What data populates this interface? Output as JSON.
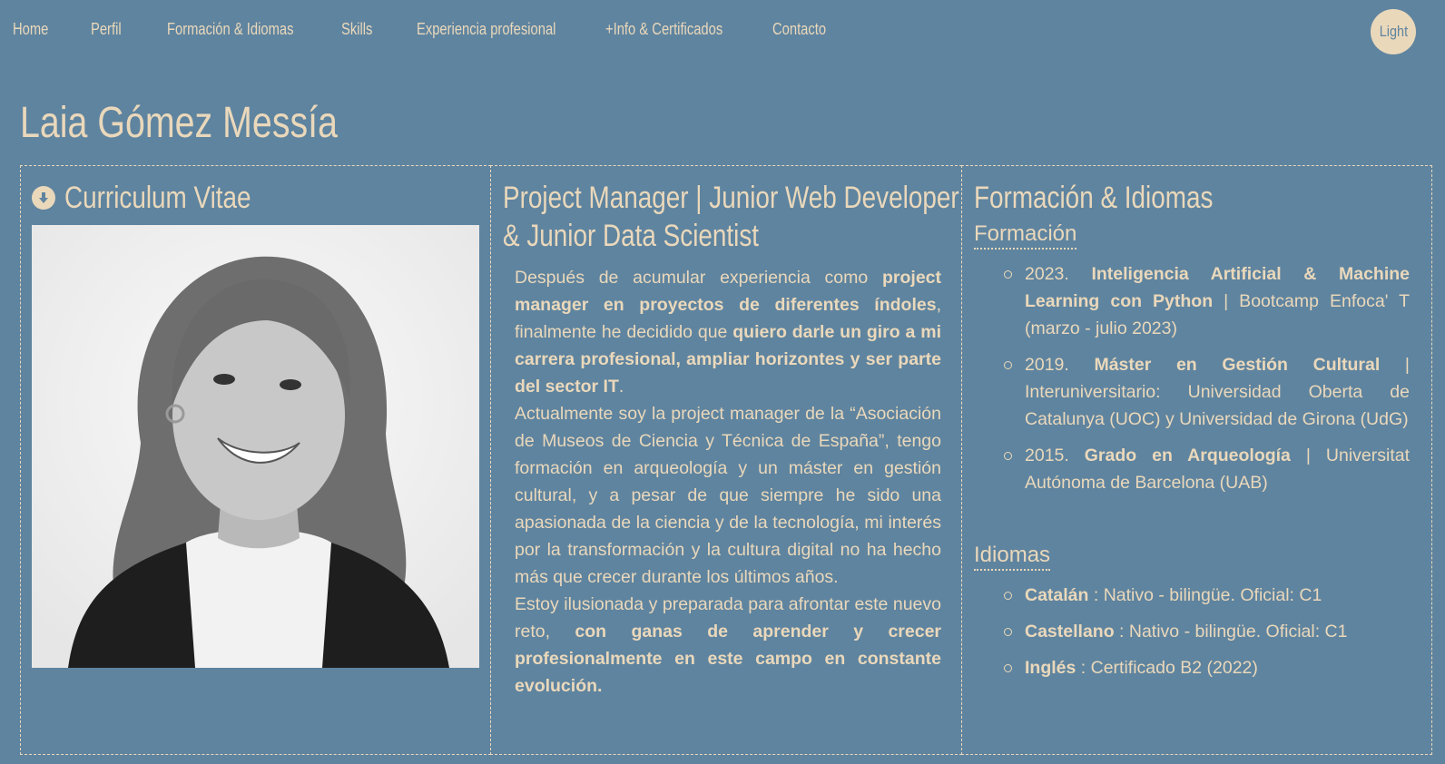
{
  "nav": {
    "items": [
      {
        "label": "Home"
      },
      {
        "label": "Perfil"
      },
      {
        "label": "Formación & Idiomas"
      },
      {
        "label": "Skills"
      },
      {
        "label": "Experiencia profesional"
      },
      {
        "label": "+Info & Certificados"
      },
      {
        "label": "Contacto"
      }
    ],
    "theme_toggle": "Light"
  },
  "name": "Laia Gómez Messía",
  "cv": {
    "title": "Curriculum Vitae",
    "download_icon": "download-circle-icon"
  },
  "profile": {
    "title_line1": "Project Manager | Junior Web Developer",
    "title_line2": "& Junior Data Scientist",
    "p1_a": "Después de acumular experiencia como ",
    "p1_b": "project manager en proyectos de diferentes índoles",
    "p1_c": ", finalmente he decidido que ",
    "p1_d": "quiero darle un giro a mi carrera profesional, ampliar horizontes y ser parte del sector IT",
    "p1_e": ".",
    "p2": "Actualmente soy la project manager de la “Asociación de Museos de Ciencia y Técnica de España”, tengo formación en arqueología y un máster en gestión cultural, y a pesar de que siempre he sido una apasionada de la ciencia y de la tecnología, mi interés por la transformación y la cultura digital no ha hecho más que crecer durante los últimos años.",
    "p3_a": "Estoy ilusionada y preparada para afrontar este nuevo reto, ",
    "p3_b": "con ganas de aprender y crecer profesionalmente en este campo en constante evolución."
  },
  "education": {
    "title": "Formación & Idiomas",
    "formacion_heading": "Formación",
    "formacion": [
      {
        "year": "2023. ",
        "title": "Inteligencia Artificial & Machine Learning con Python",
        "rest": " | Bootcamp Enfoca' T (marzo - julio 2023)"
      },
      {
        "year": "2019. ",
        "title": "Máster en Gestión Cultural",
        "rest": " | Interuniversitario: Universidad Oberta de Catalunya (UOC) y Universidad de Girona (UdG)"
      },
      {
        "year": "2015. ",
        "title": "Grado en Arqueología",
        "rest": " | Universitat Autónoma de Barcelona (UAB)"
      }
    ],
    "idiomas_heading": "Idiomas",
    "idiomas": [
      {
        "lang": "Catalán",
        "rest": " : Nativo - bilingüe. Oficial: C1"
      },
      {
        "lang": "Castellano",
        "rest": " : Nativo - bilingüe. Oficial: C1"
      },
      {
        "lang": "Inglés",
        "rest": " : Certificado B2 (2022)"
      }
    ]
  },
  "colors": {
    "background": "#5f849f",
    "accent": "#ead8bb"
  }
}
